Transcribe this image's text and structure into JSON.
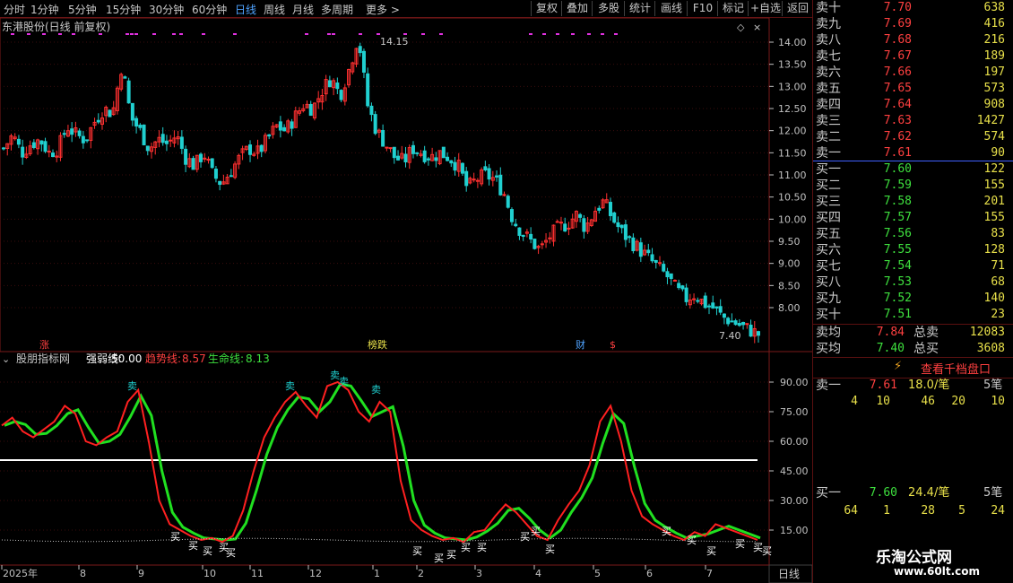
{
  "toolbar": {
    "periods": [
      "分时",
      "1分钟",
      "5分钟",
      "15分钟",
      "30分钟",
      "60分钟",
      "日线",
      "周线",
      "月线",
      "多周期",
      "更多"
    ],
    "active_period": "日线",
    "buttons": [
      "复权",
      "叠加",
      "多股",
      "统计",
      "画线",
      "F10",
      "标记",
      "+自选",
      "返回"
    ]
  },
  "main_chart": {
    "title": "东港股份(日线 前复权)",
    "y_ticks": [
      "14.00",
      "13.50",
      "13.00",
      "12.50",
      "12.00",
      "11.50",
      "11.00",
      "10.50",
      "10.00",
      "9.50",
      "9.00",
      "8.50",
      "8.00"
    ],
    "high_label": "14.15",
    "low_label": "7.40",
    "markers": {
      "zhang": "涨",
      "bangdie": "榜跌",
      "cai": "财",
      "dollar": "$"
    }
  },
  "indicator": {
    "name": "股朋指标网",
    "strong_label": "强弱线:",
    "strong_value": "50.00",
    "trend_label": "趋势线:",
    "trend_value": "8.57",
    "life_label": "生命线:",
    "life_value": "8.13",
    "y_ticks": [
      "90.00",
      "75.00",
      "60.00",
      "45.00",
      "30.00",
      "15.00"
    ],
    "buy": "买",
    "sell": "卖"
  },
  "x_axis": {
    "labels": [
      "2025年",
      "8",
      "9",
      "10",
      "11",
      "12",
      "1",
      "2",
      "3",
      "4",
      "5",
      "6",
      "7"
    ],
    "period_button": "日线"
  },
  "chart_data": {
    "type": "candlestick",
    "title": "东港股份(日线 前复权)",
    "ylim": [
      7.3,
      14.4
    ],
    "months": [
      "2025年",
      "8",
      "9",
      "10",
      "11",
      "12",
      "1",
      "2",
      "3",
      "4",
      "5",
      "6",
      "7"
    ],
    "close_path": [
      11.6,
      11.9,
      11.5,
      11.7,
      11.8,
      11.5,
      11.6,
      12.1,
      11.9,
      11.8,
      12.2,
      12.5,
      12.4,
      13.5,
      12.3,
      12.0,
      11.6,
      11.8,
      11.7,
      11.9,
      11.4,
      11.2,
      11.5,
      11.0,
      10.8,
      11.1,
      11.4,
      11.6,
      11.5,
      11.8,
      12.1,
      12.0,
      12.3,
      12.6,
      12.5,
      12.9,
      13.2,
      12.8,
      13.4,
      14.15,
      12.6,
      12.0,
      11.7,
      11.4,
      11.3,
      11.6,
      11.5,
      11.4,
      11.5,
      11.4,
      11.2,
      10.7,
      10.9,
      11.0,
      10.9,
      10.6,
      10.0,
      9.7,
      9.5,
      9.3,
      9.6,
      9.8,
      9.9,
      10.1,
      9.8,
      10.2,
      10.4,
      10.0,
      9.7,
      9.5,
      9.3,
      9.1,
      8.9,
      8.7,
      8.4,
      8.2,
      8.3,
      8.1,
      8.0,
      7.8,
      7.7,
      7.6,
      7.5,
      7.4
    ],
    "indicator_trend": [
      68,
      72,
      65,
      62,
      66,
      70,
      78,
      74,
      60,
      58,
      62,
      65,
      80,
      86,
      60,
      30,
      18,
      15,
      12,
      10,
      11,
      9,
      12,
      25,
      45,
      62,
      72,
      80,
      85,
      78,
      72,
      88,
      90,
      86,
      75,
      70,
      80,
      75,
      40,
      20,
      15,
      12,
      10,
      11,
      9,
      14,
      15,
      22,
      28,
      24,
      18,
      12,
      10,
      20,
      28,
      35,
      48,
      70,
      78,
      60,
      35,
      22,
      18,
      15,
      12,
      10,
      14,
      12,
      18,
      16,
      14,
      12,
      10
    ],
    "strong_line": 50,
    "ob_sell": [
      [
        "卖十",
        "7.70",
        "638"
      ],
      [
        "卖九",
        "7.69",
        "416"
      ],
      [
        "卖八",
        "7.68",
        "216"
      ],
      [
        "卖七",
        "7.67",
        "189"
      ],
      [
        "卖六",
        "7.66",
        "197"
      ],
      [
        "卖五",
        "7.65",
        "573"
      ],
      [
        "卖四",
        "7.64",
        "908"
      ],
      [
        "卖三",
        "7.63",
        "1427"
      ],
      [
        "卖二",
        "7.62",
        "574"
      ],
      [
        "卖一",
        "7.61",
        "90"
      ]
    ],
    "ob_buy": [
      [
        "买一",
        "7.60",
        "122"
      ],
      [
        "买二",
        "7.59",
        "155"
      ],
      [
        "买三",
        "7.58",
        "201"
      ],
      [
        "买四",
        "7.57",
        "155"
      ],
      [
        "买五",
        "7.56",
        "83"
      ],
      [
        "买六",
        "7.55",
        "128"
      ],
      [
        "买七",
        "7.54",
        "71"
      ],
      [
        "买八",
        "7.53",
        "68"
      ],
      [
        "买九",
        "7.52",
        "140"
      ],
      [
        "买十",
        "7.51",
        "23"
      ]
    ]
  },
  "orderbook": {
    "avg_sell_label": "卖均",
    "avg_sell": "7.84",
    "total_sell_label": "总卖",
    "total_sell": "12083",
    "avg_buy_label": "买均",
    "avg_buy": "7.40",
    "total_buy_label": "总买",
    "total_buy": "3608",
    "view_1000": "查看千档盘口",
    "sell1": {
      "label": "卖一",
      "price": "7.61",
      "per": "18.0/笔",
      "count": "5笔",
      "orders": [
        "4",
        "10",
        "46",
        "20",
        "10"
      ]
    },
    "buy1": {
      "label": "买一",
      "price": "7.60",
      "per": "24.4/笔",
      "count": "5笔",
      "orders": [
        "64",
        "1",
        "28",
        "5",
        "24"
      ]
    }
  },
  "watermark": {
    "name": "乐淘公式网",
    "url": "www.60lt.com"
  },
  "colors": {
    "up": "#ff3030",
    "down": "#20d0d0",
    "grid": "#7a1a1a",
    "axis": "#c0c0c0",
    "trend_red": "#ff2020",
    "trend_green": "#20e020",
    "magenta": "#e030e0"
  }
}
